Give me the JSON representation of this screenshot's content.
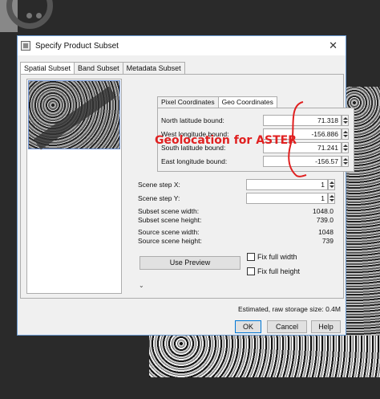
{
  "window": {
    "title": "Specify Product Subset",
    "close_icon": "close-icon"
  },
  "tabs": [
    {
      "label": "Spatial Subset",
      "active": true
    },
    {
      "label": "Band Subset",
      "active": false
    },
    {
      "label": "Metadata Subset",
      "active": false
    }
  ],
  "coord_tabs": [
    {
      "label": "Pixel Coordinates",
      "active": false
    },
    {
      "label": "Geo Coordinates",
      "active": true
    }
  ],
  "geo_fields": [
    {
      "label": "North latitude bound:",
      "value": "71.318"
    },
    {
      "label": "West longitude bound:",
      "value": "-156.886"
    },
    {
      "label": "South latitude bound:",
      "value": "71.241"
    },
    {
      "label": "East longitude bound:",
      "value": "-156.57"
    }
  ],
  "scene_steps": [
    {
      "label": "Scene step X:",
      "value": "1"
    },
    {
      "label": "Scene step Y:",
      "value": "1"
    }
  ],
  "info_rows": [
    {
      "label": "Subset scene width:",
      "value": "1048.0"
    },
    {
      "label": "Subset scene height:",
      "value": "739.0"
    },
    {
      "label": "Source scene width:",
      "value": "1048"
    },
    {
      "label": "Source scene height:",
      "value": "739"
    }
  ],
  "preview_button": "Use Preview",
  "checkboxes": [
    {
      "label": "Fix full width",
      "checked": false
    },
    {
      "label": "Fix full height",
      "checked": false
    }
  ],
  "storage": "Estimated, raw storage size: 0.4M",
  "buttons": {
    "ok": "OK",
    "cancel": "Cancel",
    "help": "Help"
  },
  "annotation": "Geolocation for ASTER",
  "colors": {
    "annotation": "#e02020",
    "accent": "#0078d7"
  }
}
